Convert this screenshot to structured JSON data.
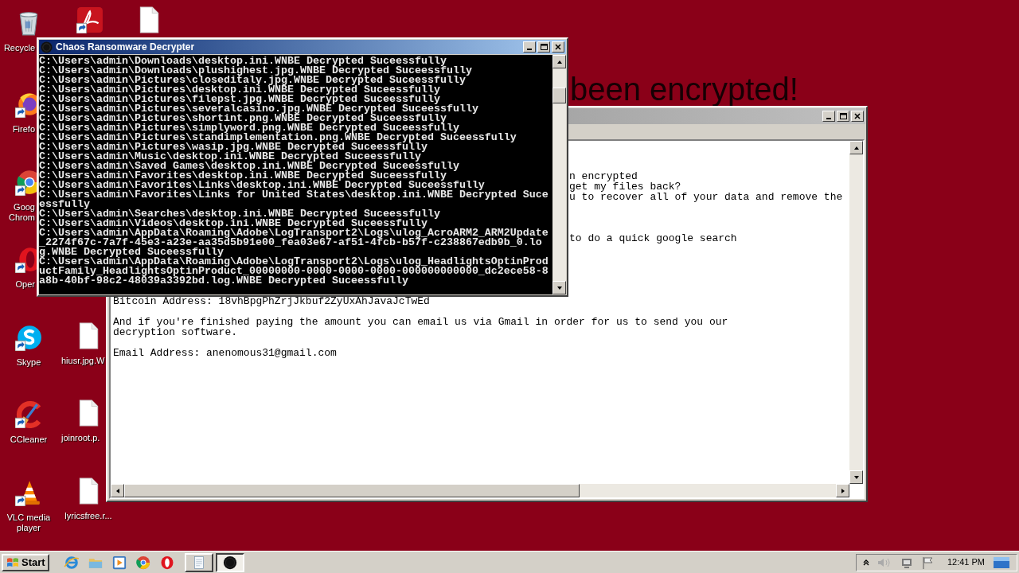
{
  "wallpaper_text": "been encrypted!",
  "desktop_icons": [
    {
      "kind": "recycle",
      "label": "Recycle",
      "cut": true
    },
    {
      "kind": "pdf"
    },
    {
      "kind": "file"
    },
    {
      "kind": "firefox",
      "label": "Firefo",
      "cut": true
    },
    {
      "kind": "chrome",
      "label": "Goog Chrom",
      "cut": true
    },
    {
      "kind": "opera",
      "label": "Oper",
      "cut": true
    },
    {
      "kind": "skype",
      "label": "Skype",
      "cut": false
    },
    {
      "kind": "file",
      "label": "hiusr.jpg.W",
      "cut": true
    },
    {
      "kind": "ccleaner",
      "label": "CCleaner",
      "cut": false
    },
    {
      "kind": "file",
      "label": "joinroot.p.",
      "cut": true
    },
    {
      "kind": "vlc",
      "label": "VLC media player",
      "cut": false
    },
    {
      "kind": "file",
      "label": "lyricsfree.r...",
      "cut": false
    }
  ],
  "notepad": {
    "upper_fragments": [
      "n encrypted",
      "get my files back?",
      "u to recover all of your data and remove the",
      "to do a quick google search"
    ],
    "bitcoin_line": "Bitcoin Address: 18vhBpgPhZrjJkbuf2ZyUxAhJavaJcTwEd",
    "paragraph": "And if you're finished paying the amount you can email us via Gmail in order for us to send you our decryption software.",
    "email_line": "Email Address: anenomous31@gmail.com"
  },
  "decrypter": {
    "title": "Chaos Ransomware Decrypter",
    "console_lines": [
      "C:\\Users\\admin\\Downloads\\desktop.ini.WNBE Decrypted Suceessfully",
      "C:\\Users\\admin\\Downloads\\plushighest.jpg.WNBE Decrypted Suceessfully",
      "C:\\Users\\admin\\Pictures\\closeditaly.jpg.WNBE Decrypted Suceessfully",
      "C:\\Users\\admin\\Pictures\\desktop.ini.WNBE Decrypted Suceessfully",
      "C:\\Users\\admin\\Pictures\\filepst.jpg.WNBE Decrypted Suceessfully",
      "C:\\Users\\admin\\Pictures\\severalcasino.jpg.WNBE Decrypted Suceessfully",
      "C:\\Users\\admin\\Pictures\\shortint.png.WNBE Decrypted Suceessfully",
      "C:\\Users\\admin\\Pictures\\simplyword.png.WNBE Decrypted Suceessfully",
      "C:\\Users\\admin\\Pictures\\standimplementation.png.WNBE Decrypted Suceessfully",
      "C:\\Users\\admin\\Pictures\\wasip.jpg.WNBE Decrypted Suceessfully",
      "C:\\Users\\admin\\Music\\desktop.ini.WNBE Decrypted Suceessfully",
      "C:\\Users\\admin\\Saved Games\\desktop.ini.WNBE Decrypted Suceessfully",
      "C:\\Users\\admin\\Favorites\\desktop.ini.WNBE Decrypted Suceessfully",
      "C:\\Users\\admin\\Favorites\\Links\\desktop.ini.WNBE Decrypted Suceessfully",
      "C:\\Users\\admin\\Favorites\\Links for United States\\desktop.ini.WNBE Decrypted Suceessfully",
      "C:\\Users\\admin\\Searches\\desktop.ini.WNBE Decrypted Suceessfully",
      "C:\\Users\\admin\\Videos\\desktop.ini.WNBE Decrypted Suceessfully",
      "C:\\Users\\admin\\AppData\\Roaming\\Adobe\\LogTransport2\\Logs\\ulog_AcroARM2_ARM2Update_2274f67c-7a7f-45e3-a23e-aa35d5b91e00_fea03e67-af51-4fcb-b57f-c238867edb9b_0.log.WNBE Decrypted Suceessfully",
      "C:\\Users\\admin\\AppData\\Roaming\\Adobe\\LogTransport2\\Logs\\ulog_HeadlightsOptinProductFamily_HeadlightsOptinProduct_00000000-0000-0000-0000-000000000000_dc2ece58-8a8b-40bf-98c2-48039a3392bd.log.WNBE Decrypted Suceessfully"
    ]
  },
  "taskbar": {
    "start": "Start",
    "quick_launch": [
      {
        "kind": "ie"
      },
      {
        "kind": "explorer"
      },
      {
        "kind": "media"
      },
      {
        "kind": "chrome"
      },
      {
        "kind": "opera"
      }
    ],
    "tasks": [
      {
        "kind": "notepad",
        "selected": false
      },
      {
        "kind": "decrypter",
        "selected": true
      }
    ],
    "clock": "12:41 PM"
  }
}
